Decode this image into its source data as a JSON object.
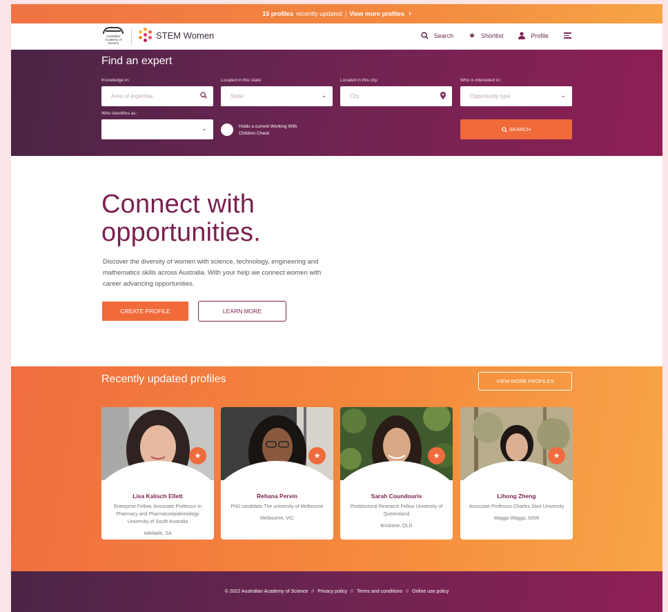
{
  "banner": {
    "count_label": "15 profiles",
    "text": "recently updated",
    "sep": "|",
    "link": "View more profiles",
    "chevron": "›"
  },
  "header": {
    "aas_logo_text": "Australian Academy of Science",
    "brand": "STEM Women",
    "nav": [
      {
        "label": "Search",
        "icon": "search-icon"
      },
      {
        "label": "Shortlist",
        "icon": "star-icon"
      },
      {
        "label": "Profile",
        "icon": "person-icon"
      }
    ]
  },
  "search": {
    "title": "Find an expert",
    "knowledge_label": "Knowledge in:",
    "knowledge_placeholder": "Area of expertise",
    "state_label": "Located in this state:",
    "state_value": "State",
    "city_label": "Located in this city:",
    "city_placeholder": "City",
    "interest_label": "Who is interested in:",
    "interest_value": "Opportunity type",
    "identity_label": "Who identifies as:",
    "identity_value": "",
    "wwcc_label": "Holds a current Working With Children Check",
    "search_button": "SEARCH"
  },
  "hero": {
    "title_line1": "Connect with",
    "title_line2": "opportunities.",
    "description": "Discover the diversity of women with science, technology, engineering and mathematics skills across Australia. With your help we connect women with career advancing opportunities.",
    "create_button": "CREATE PROFILE",
    "learn_button": "LEARN MORE"
  },
  "recent": {
    "title": "Recently updated profiles",
    "view_button": "VIEW MORE PROFILES",
    "profiles": [
      {
        "name": "Lisa Kalisch Ellett",
        "role": "Enterprise Fellow, Associate Professor in Pharmacy and Pharmacoepidemiology University of South Australia",
        "location": "Adelaide, SA"
      },
      {
        "name": "Rehana Pervin",
        "role": "PhD candidate The university of Melbourne",
        "location": "Melbourne, VIC"
      },
      {
        "name": "Sarah Coundouris",
        "role": "Postdoctoral Research Fellow University of Queensland",
        "location": "Brisbane, QLD"
      },
      {
        "name": "Lihong Zheng",
        "role": "Associate Professor Charles Sturt University",
        "location": "Wagga Wagga, NSW"
      }
    ]
  },
  "footer": {
    "copyright": "© 2022 Australian Academy of Science",
    "sep": "//",
    "links": [
      "Privacy policy",
      "Terms and conditions",
      "Online use policy"
    ]
  },
  "colors": {
    "accent_orange": "#f06a3a",
    "brand_plum": "#7a1f4f"
  }
}
